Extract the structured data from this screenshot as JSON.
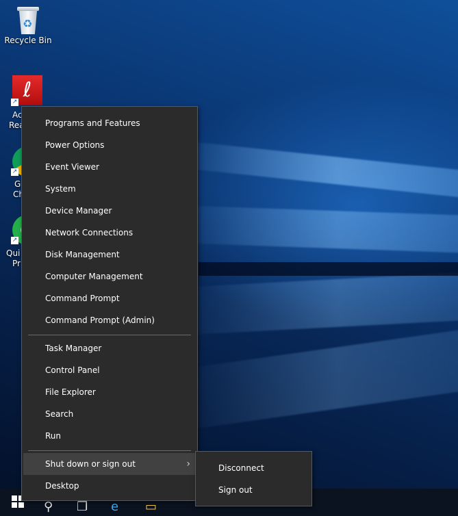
{
  "desktop": {
    "icons": [
      {
        "label": "Recycle Bin"
      },
      {
        "label_fragment_1": "Ac",
        "label_fragment_2": "Rea"
      },
      {
        "label_fragment_1": "G",
        "label_fragment_2": "Ch"
      },
      {
        "label_fragment_1": "Qui",
        "label_fragment_2": "Pr"
      }
    ]
  },
  "context_menu": {
    "items_group1": [
      "Programs and Features",
      "Power Options",
      "Event Viewer",
      "System",
      "Device Manager",
      "Network Connections",
      "Disk Management",
      "Computer Management",
      "Command Prompt",
      "Command Prompt (Admin)"
    ],
    "items_group2": [
      "Task Manager",
      "Control Panel",
      "File Explorer",
      "Search",
      "Run"
    ],
    "items_group3": [
      "Shut down or sign out",
      "Desktop"
    ],
    "highlighted_item": "Shut down or sign out"
  },
  "submenu": {
    "items": [
      "Disconnect",
      "Sign out"
    ]
  },
  "colors": {
    "menu_bg": "#2b2b2b",
    "menu_hover": "#414141",
    "menu_text": "#ffffff"
  }
}
